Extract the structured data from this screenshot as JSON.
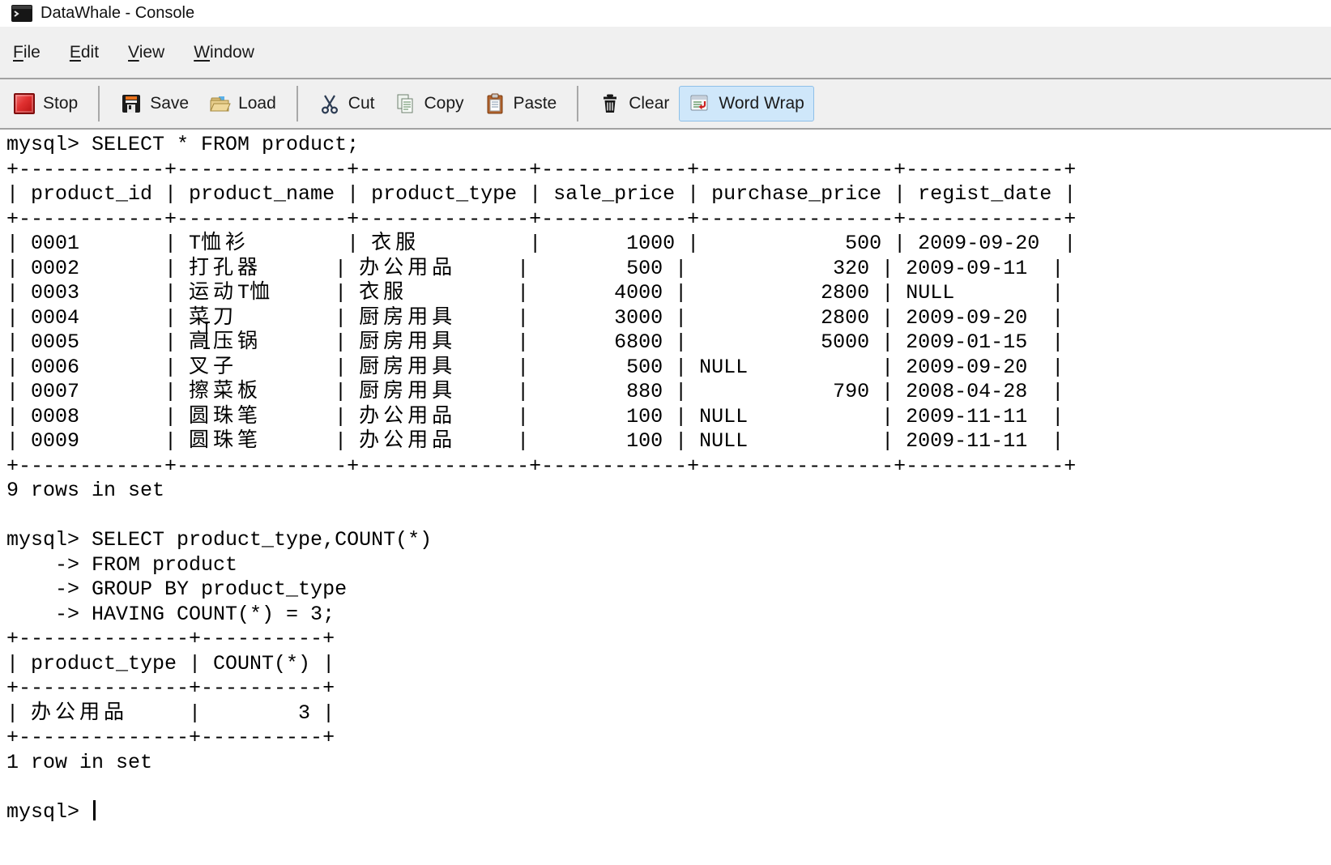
{
  "window": {
    "title": "DataWhale - Console"
  },
  "menubar": {
    "items": [
      {
        "label": "File",
        "mnemonic": "F",
        "rest": "ile"
      },
      {
        "label": "Edit",
        "mnemonic": "E",
        "rest": "dit"
      },
      {
        "label": "View",
        "mnemonic": "V",
        "rest": "iew"
      },
      {
        "label": "Window",
        "mnemonic": "W",
        "rest": "indow"
      }
    ]
  },
  "toolbar": {
    "groups": [
      {
        "items": [
          {
            "label": "Stop",
            "icon": "stop-icon"
          }
        ]
      },
      {
        "items": [
          {
            "label": "Save",
            "icon": "save-icon"
          },
          {
            "label": "Load",
            "icon": "load-icon"
          }
        ]
      },
      {
        "items": [
          {
            "label": "Cut",
            "icon": "cut-icon"
          },
          {
            "label": "Copy",
            "icon": "copy-icon"
          },
          {
            "label": "Paste",
            "icon": "paste-icon"
          }
        ]
      },
      {
        "items": [
          {
            "label": "Clear",
            "icon": "clear-icon"
          },
          {
            "label": "Word Wrap",
            "icon": "word-wrap-icon",
            "active": true
          }
        ]
      }
    ]
  },
  "console": {
    "current_prompt": "mysql>",
    "queries": [
      {
        "prompt": "mysql>",
        "sql": "SELECT * FROM product;",
        "columns": [
          "product_id",
          "product_name",
          "product_type",
          "sale_price",
          "purchase_price",
          "regist_date"
        ],
        "rows": [
          [
            "0001",
            "T恤衫",
            "衣服",
            "1000",
            "500",
            "2009-09-20"
          ],
          [
            "0002",
            "打孔器",
            "办公用品",
            "500",
            "320",
            "2009-09-11"
          ],
          [
            "0003",
            "运动T恤",
            "衣服",
            "4000",
            "2800",
            "NULL"
          ],
          [
            "0004",
            "菜刀",
            "厨房用具",
            "3000",
            "2800",
            "2009-09-20"
          ],
          [
            "0005",
            "高压锅",
            "厨房用具",
            "6800",
            "5000",
            "2009-01-15"
          ],
          [
            "0006",
            "叉子",
            "厨房用具",
            "500",
            "NULL",
            "2009-09-20"
          ],
          [
            "0007",
            "擦菜板",
            "厨房用具",
            "880",
            "790",
            "2008-04-28"
          ],
          [
            "0008",
            "圆珠笔",
            "办公用品",
            "100",
            "NULL",
            "2009-11-11"
          ],
          [
            "0009",
            "圆珠笔",
            "办公用品",
            "100",
            "NULL",
            "2009-11-11"
          ]
        ],
        "status": "9 rows in set"
      },
      {
        "prompt": "mysql>",
        "sql": "SELECT product_type,COUNT(*) FROM product GROUP BY product_type HAVING COUNT(*) = 3;",
        "columns": [
          "product_type",
          "COUNT(*)"
        ],
        "rows": [
          [
            "办公用品",
            "3"
          ]
        ],
        "status": "1 row in set"
      }
    ],
    "lines": [
      "mysql> SELECT * FROM product;",
      "+------------+--------------+--------------+------------+----------------+-------------+",
      "| product_id | product_name | product_type | sale_price | purchase_price | regist_date |",
      "+------------+--------------+--------------+------------+----------------+-------------+",
      "| 0001       | T恤衫        | 衣服         |       1000 |            500 | 2009-09-20  |",
      "| 0002       | 打孔器      | 办公用品     |        500 |            320 | 2009-09-11  |",
      "| 0003       | 运动T恤     | 衣服         |       4000 |           2800 | NULL        |",
      "| 0004       | 菜刀        | 厨房用具     |       3000 |           2800 | 2009-09-20  |",
      "| 0005       | 高压锅      | 厨房用具     |       6800 |           5000 | 2009-01-15  |",
      "| 0006       | 叉子        | 厨房用具     |        500 | NULL           | 2009-09-20  |",
      "| 0007       | 擦菜板      | 厨房用具     |        880 |            790 | 2008-04-28  |",
      "| 0008       | 圆珠笔      | 办公用品     |        100 | NULL           | 2009-11-11  |",
      "| 0009       | 圆珠笔      | 办公用品     |        100 | NULL           | 2009-11-11  |",
      "+------------+--------------+--------------+------------+----------------+-------------+",
      "9 rows in set",
      "",
      "mysql> SELECT product_type,COUNT(*)",
      "    -> FROM product",
      "    -> GROUP BY product_type",
      "    -> HAVING COUNT(*) = 3;",
      "+--------------+----------+",
      "| product_type | COUNT(*) |",
      "+--------------+----------+",
      "| 办公用品     |        3 |",
      "+--------------+----------+",
      "1 row in set",
      "",
      "mysql> "
    ]
  },
  "colors": {
    "toolbar_bg": "#f0f0f0",
    "console_bg": "#ffffff",
    "text": "#000000",
    "active_toggle_bg": "#cfe7fa",
    "active_toggle_border": "#8fc0e8",
    "stop_red": "#c81e1e"
  }
}
